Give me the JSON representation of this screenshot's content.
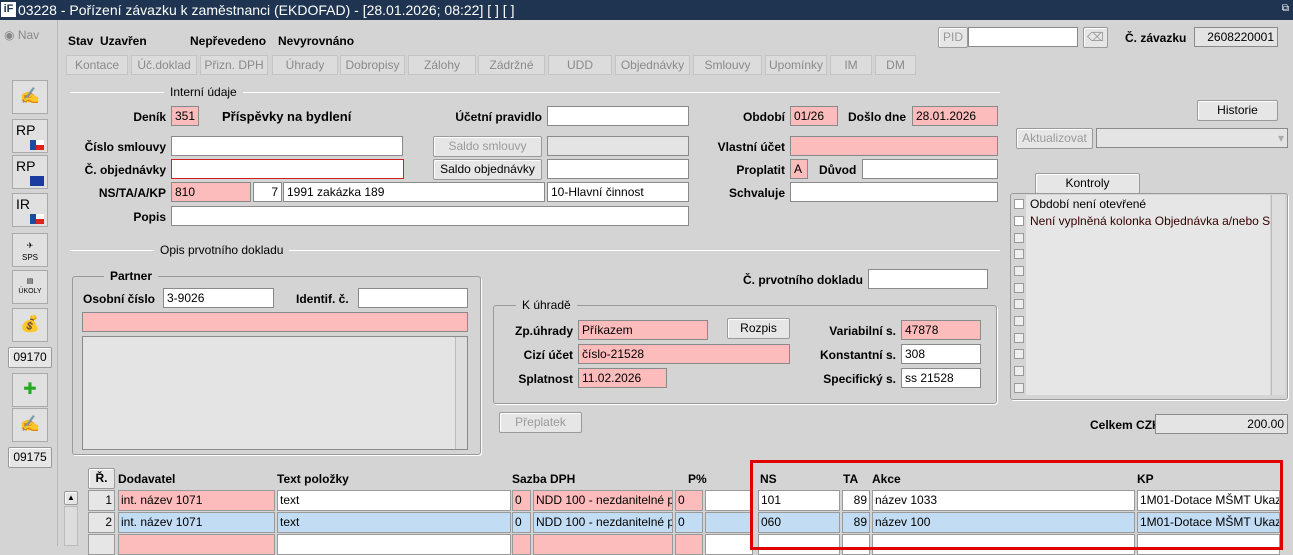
{
  "title": "03228 - Pořízení závazku k zaměstnanci (EKDOFAD) - [28.01.2026; 08:22]  [ ] [ ]",
  "logo": "iF",
  "nav": "Nav",
  "status": {
    "stav_label": "Stav",
    "stav": "Uzavřen",
    "prevod": "Nepřevedeno",
    "vyrovnani": "Nevyrovnáno"
  },
  "pid": {
    "label": "PID",
    "value": ""
  },
  "zavazek": {
    "label": "Č. závazku",
    "value": "2608220001"
  },
  "tabs": [
    "Kontace",
    "Úč.doklad",
    "Přizn. DPH",
    "Úhrady",
    "Dobropisy",
    "Zálohy",
    "Zádržné",
    "UDD",
    "Objednávky",
    "Smlouvy",
    "Upomínky",
    "IM",
    "DM"
  ],
  "left": {
    "rp": "RP",
    "ir": "IR",
    "sps": "SPS",
    "ukoly": "ÚKOLY",
    "code1": "09170",
    "code2": "09175"
  },
  "interni": {
    "title": "Interní údaje",
    "denik_label": "Deník",
    "denik": "351",
    "denik_name": "Příspěvky na bydlení",
    "ucetni_label": "Účetní pravidlo",
    "ucetni": "",
    "obdobi_label": "Období",
    "obdobi": "01/26",
    "doslo_label": "Došlo dne",
    "doslo": "28.01.2026",
    "smlouva_label": "Číslo smlouvy",
    "smlouva": "",
    "saldo_smlouvy": "Saldo smlouvy",
    "vlastni_label": "Vlastní účet",
    "vlastni": "",
    "objednavka_label": "Č. objednávky",
    "objednavka": "",
    "saldo_objednavky": "Saldo objednávky",
    "proplatit_label": "Proplatit",
    "proplatit": "A",
    "duvod_label": "Důvod",
    "duvod": "",
    "ns_label": "NS/TA/A/KP",
    "ns": "810",
    "ta": "7",
    "akce": "1991 zakázka 189",
    "kp": "10-Hlavní činnost",
    "schvaluje_label": "Schvaluje",
    "schvaluje": "",
    "popis_label": "Popis",
    "popis": ""
  },
  "right": {
    "historie": "Historie",
    "aktualizovat": "Aktualizovat",
    "kontroly": "Kontroly",
    "checks": [
      "Období není otevřené",
      "Není vyplněná kolonka Objednávka a/nebo S"
    ],
    "celkem_label": "Celkem CZK",
    "celkem": "200.00"
  },
  "opis": {
    "title": "Opis prvotního dokladu",
    "partner": "Partner",
    "osobni_label": "Osobní číslo",
    "osobni": "3-9026",
    "identif_label": "Identif. č.",
    "identif": "",
    "prvotni_label": "Č. prvotního dokladu",
    "prvotni": "",
    "k_uhrade": "K úhradě",
    "zp_label": "Zp.úhrady",
    "zp": "Příkazem",
    "rozpis": "Rozpis",
    "cizi_label": "Cizí účet",
    "cizi": "číslo-21528",
    "splatnost_label": "Splatnost",
    "splatnost": "11.02.2026",
    "vs_label": "Variabilní s.",
    "vs": "47878",
    "ks_label": "Konstantní s.",
    "ks": "308",
    "ss_label": "Specifický s.",
    "ss": "ss 21528",
    "preplatek": "Přeplatek"
  },
  "table": {
    "headers": [
      "Ř.",
      "Dodavatel",
      "Text položky",
      "Sazba DPH",
      "P%",
      "NS",
      "TA",
      "Akce",
      "KP"
    ],
    "rows": [
      {
        "r": "1",
        "dodavatel": "int. název 1071",
        "text": "text",
        "sazba": "0",
        "dph": "NDD 100 - nezdanitelné p",
        "p": "0",
        "ns": "101",
        "ta": "89",
        "akce": "název 1033",
        "kp": "1M01-Dotace MŠMT Ukaz"
      },
      {
        "r": "2",
        "dodavatel": "int. název 1071",
        "text": "text",
        "sazba": "0",
        "dph": "NDD 100 - nezdanitelné p",
        "p": "0",
        "ns": "060",
        "ta": "89",
        "akce": "název 100",
        "kp": "1M01-Dotace MŠMT Ukaz"
      }
    ]
  }
}
